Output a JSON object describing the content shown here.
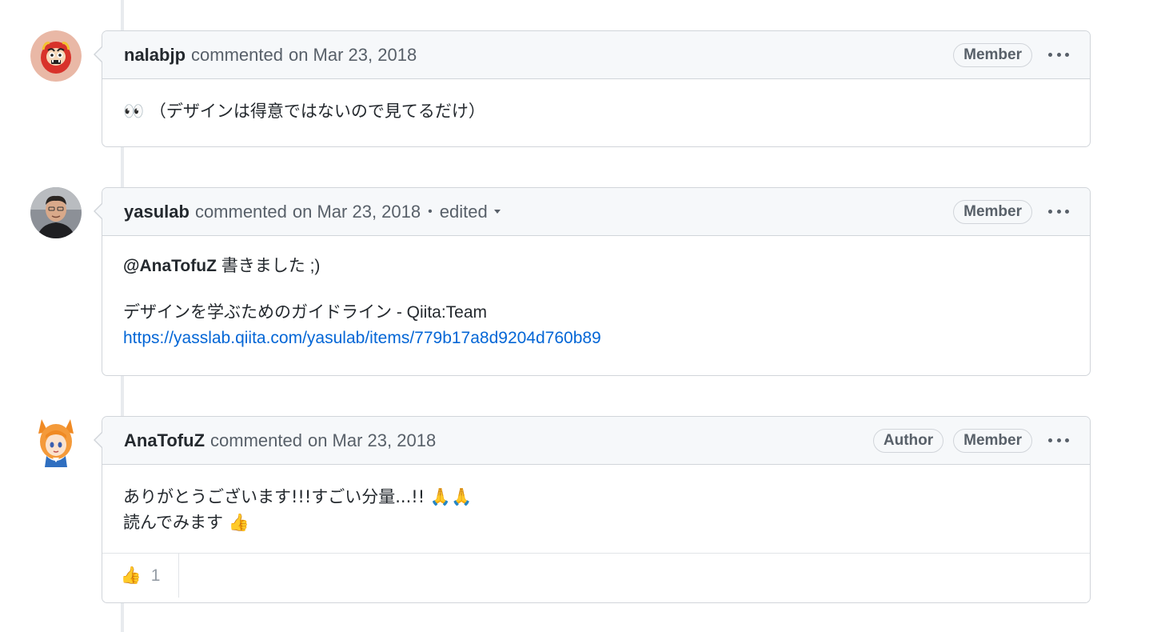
{
  "comments": [
    {
      "author": "nalabjp",
      "action": "commented",
      "date": "on Mar 23, 2018",
      "badges": [
        "Member"
      ],
      "avatar": "red-daruma-avatar",
      "lines": [
        "👀 （デザインは得意ではないので見てるだけ）"
      ]
    },
    {
      "author": "yasulab",
      "action": "commented",
      "date": "on Mar 23, 2018",
      "separator": "•",
      "edited_label": "edited",
      "badges": [
        "Member"
      ],
      "avatar": "person-photo-avatar",
      "mention": "@AnaTofuZ",
      "mention_text": " 書きました ;)",
      "line2": "デザインを学ぶためのガイドライン - Qiita:Team",
      "link": "https://yasslab.qiita.com/yasulab/items/779b17a8d9204d760b89"
    },
    {
      "author": "AnaTofuZ",
      "action": "commented",
      "date": "on Mar 23, 2018",
      "badges": [
        "Author",
        "Member"
      ],
      "avatar": "fox-girl-avatar",
      "lines": [
        "ありがとうございます!!!すごい分量...!! 🙏🙏",
        "読んでみます 👍"
      ],
      "reaction": {
        "emoji": "👍",
        "count": "1"
      }
    }
  ],
  "colors": {
    "header_bg": "#f6f8fa",
    "border": "#d1d5da",
    "link": "#0366d6",
    "muted": "#586069"
  }
}
